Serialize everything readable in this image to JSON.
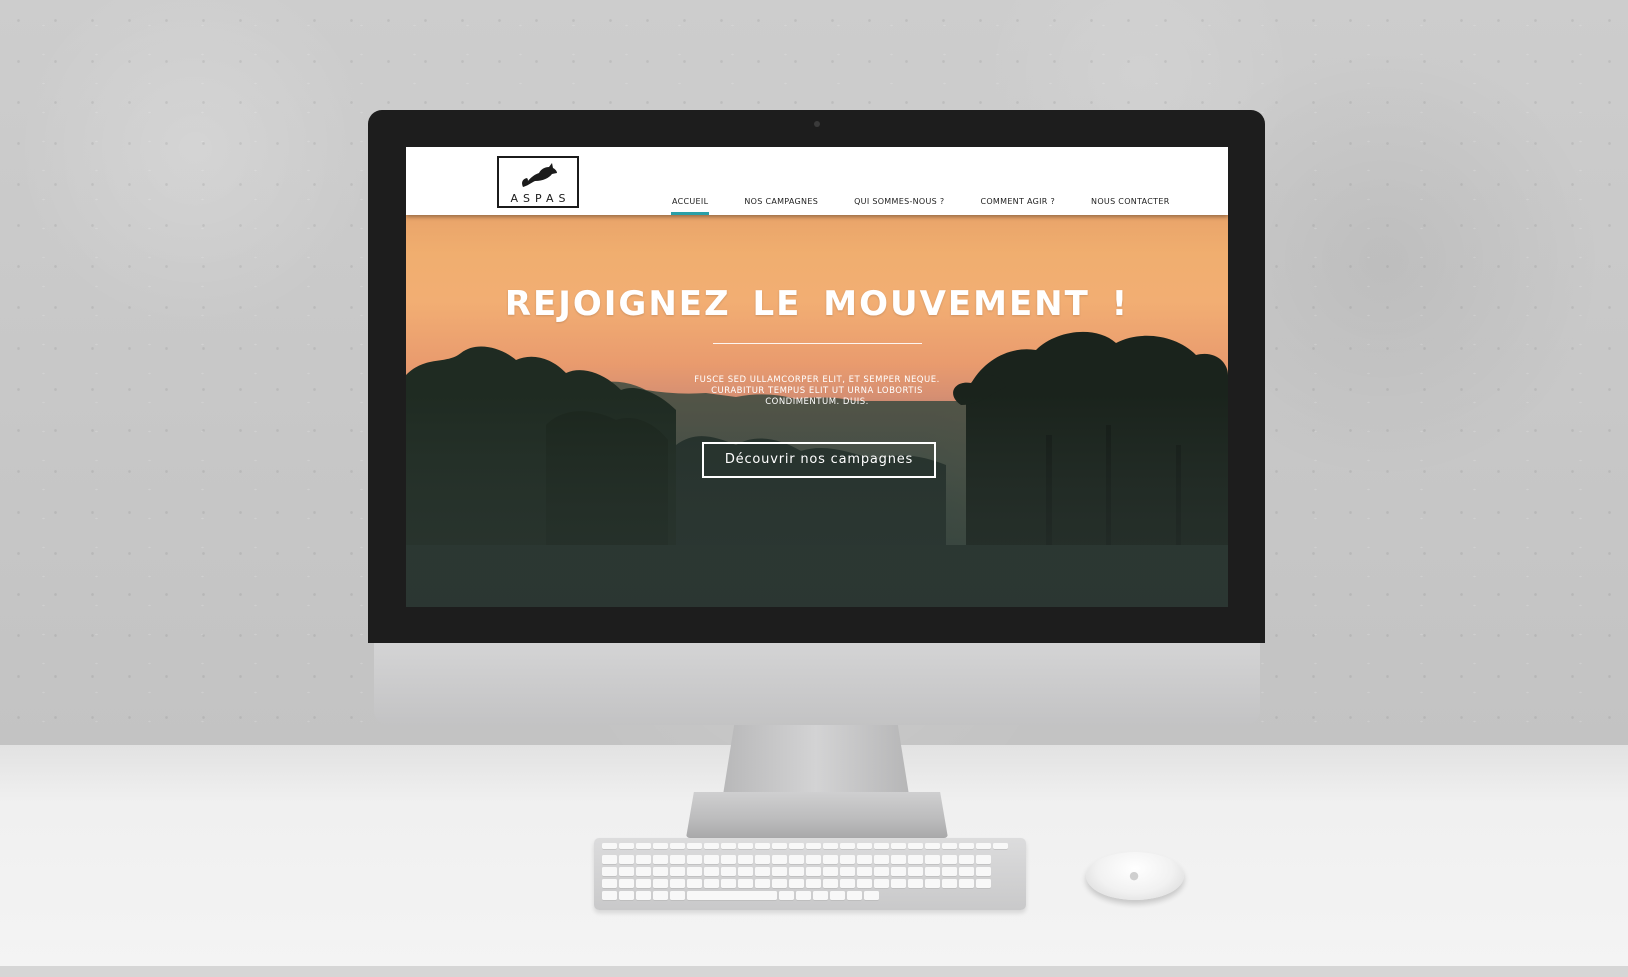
{
  "site": {
    "logo_text": "ASPAS",
    "nav": {
      "items": [
        {
          "label": "Accueil",
          "active": true
        },
        {
          "label": "Nos campagnes",
          "active": false
        },
        {
          "label": "Qui sommes-nous ?",
          "active": false
        },
        {
          "label": "Comment agir ?",
          "active": false
        },
        {
          "label": "Nous contacter",
          "active": false
        }
      ],
      "active_color": "#2aa0a8"
    },
    "hero": {
      "title": "REJOIGNEZ LE MOUVEMENT !",
      "text_line1": "Fusce sed ullamcorper elit, et semper neque.",
      "text_line2": "Curabitur tempus elit ut urna lobortis",
      "text_line3": "condimentum. Duis.",
      "button_label": "Découvrir nos campagnes"
    }
  },
  "icons": {
    "logo": "fox-icon",
    "mouse_logo": "apple-icon"
  }
}
